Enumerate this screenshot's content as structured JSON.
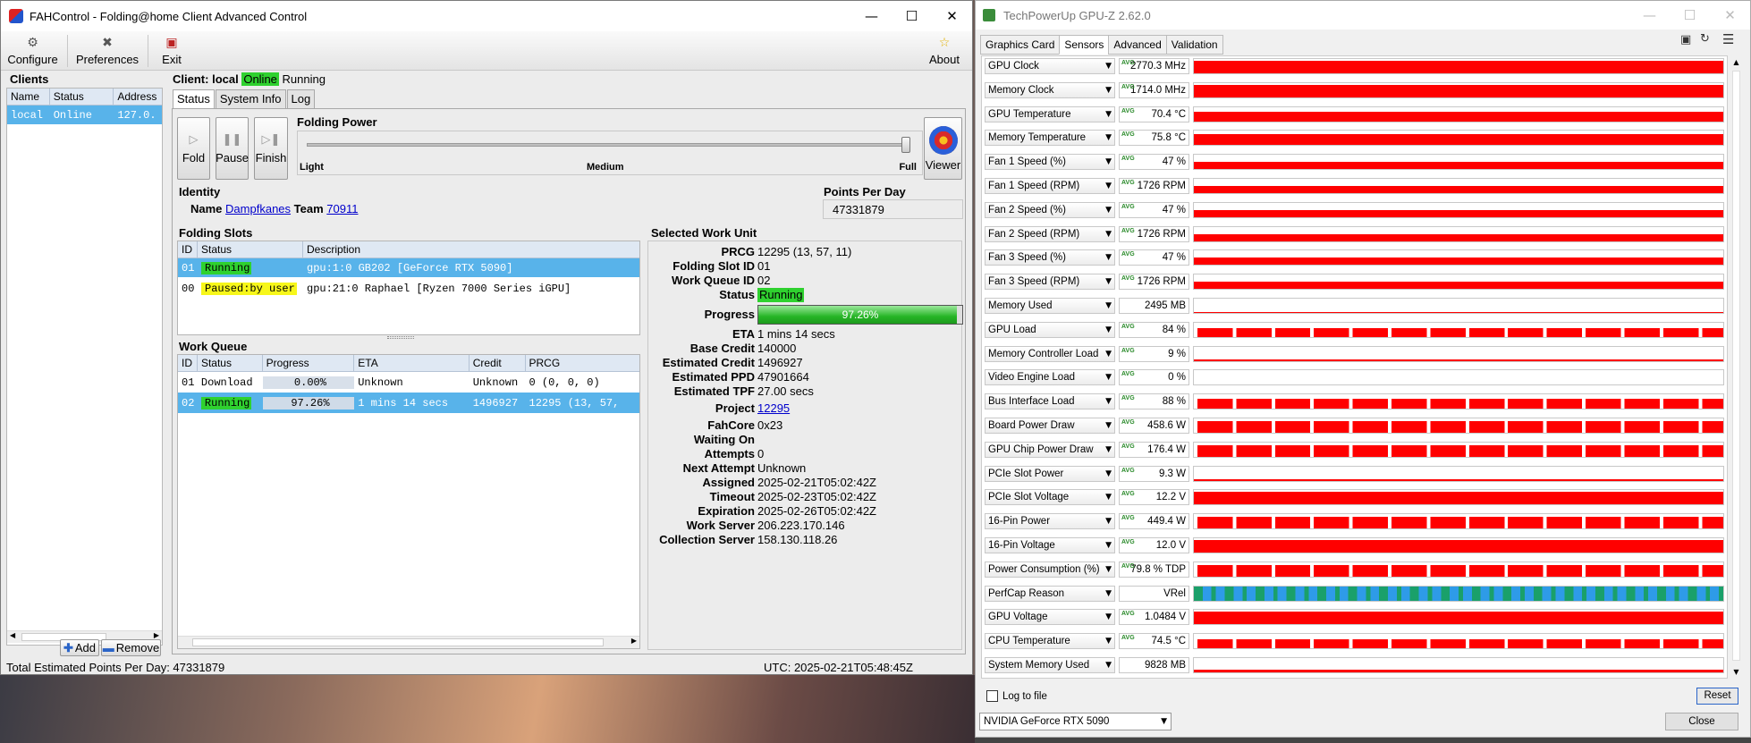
{
  "fah": {
    "window_title": "FAHControl - Folding@home Client Advanced Control",
    "toolbar": {
      "configure": "Configure",
      "preferences": "Preferences",
      "exit": "Exit",
      "about": "About"
    },
    "clients": {
      "title": "Clients",
      "headers": [
        "Name",
        "Status",
        "Address"
      ],
      "row": {
        "name": "local",
        "status": "Online",
        "address": "127.0."
      },
      "add": "Add",
      "remove": "Remove"
    },
    "client_header": {
      "label": "Client:",
      "name": "local",
      "online": "Online",
      "state": "Running"
    },
    "tabs": [
      "Status",
      "System Info",
      "Log"
    ],
    "buttons": {
      "fold": "Fold",
      "pause": "Pause",
      "finish": "Finish",
      "viewer": "Viewer"
    },
    "folding_power": {
      "title": "Folding Power",
      "light": "Light",
      "medium": "Medium",
      "full": "Full",
      "level": 1.0
    },
    "identity": {
      "title": "Identity",
      "name_label": "Name",
      "name": "Dampfkanes",
      "team_label": "Team",
      "team": "70911"
    },
    "ppd": {
      "title": "Points Per Day",
      "value": "47331879"
    },
    "slots": {
      "title": "Folding Slots",
      "headers": [
        "ID",
        "Status",
        "Description"
      ],
      "rows": [
        {
          "id": "01",
          "status": "Running",
          "desc": "gpu:1:0 GB202 [GeForce RTX 5090]"
        },
        {
          "id": "00",
          "status": "Paused:by user",
          "desc": "gpu:21:0 Raphael [Ryzen 7000 Series iGPU]"
        }
      ]
    },
    "queue": {
      "title": "Work Queue",
      "headers": [
        "ID",
        "Status",
        "Progress",
        "ETA",
        "Credit",
        "PRCG"
      ],
      "rows": [
        {
          "id": "01",
          "status": "Download",
          "progress": "0.00%",
          "eta": "Unknown",
          "credit": "Unknown",
          "prcg": "0 (0, 0, 0)"
        },
        {
          "id": "02",
          "status": "Running",
          "progress": "97.26%",
          "eta": "1 mins 14 secs",
          "credit": "1496927",
          "prcg": "12295 (13, 57,"
        }
      ]
    },
    "wu": {
      "title": "Selected Work Unit",
      "prcg_l": "PRCG",
      "prcg": "12295 (13, 57, 11)",
      "slot_l": "Folding Slot ID",
      "slot": "01",
      "queue_l": "Work Queue ID",
      "queue": "02",
      "status_l": "Status",
      "status": "Running",
      "progress_l": "Progress",
      "progress": "97.26%",
      "progress_fraction": 0.9726,
      "eta_l": "ETA",
      "eta": "1 mins 14 secs",
      "base_l": "Base Credit",
      "base": "140000",
      "est_credit_l": "Estimated Credit",
      "est_credit": "1496927",
      "est_ppd_l": "Estimated PPD",
      "est_ppd": "47901664",
      "est_tpf_l": "Estimated TPF",
      "est_tpf": "27.00 secs",
      "project_l": "Project",
      "project": "12295",
      "core_l": "FahCore",
      "core": "0x23",
      "waiting_l": "Waiting On",
      "waiting": "",
      "attempts_l": "Attempts",
      "attempts": "0",
      "next_l": "Next Attempt",
      "next": "Unknown",
      "assigned_l": "Assigned",
      "assigned": "2025-02-21T05:02:42Z",
      "timeout_l": "Timeout",
      "timeout": "2025-02-23T05:02:42Z",
      "expiration_l": "Expiration",
      "expiration": "2025-02-26T05:02:42Z",
      "ws_l": "Work Server",
      "ws": "206.223.170.146",
      "cs_l": "Collection Server",
      "cs": "158.130.118.26"
    },
    "statusbar": {
      "total": "Total Estimated Points Per Day: 47331879",
      "utc": "UTC: 2025-02-21T05:48:45Z"
    }
  },
  "gpuz": {
    "window_title": "TechPowerUp GPU-Z 2.62.0",
    "tabs": [
      "Graphics Card",
      "Sensors",
      "Advanced",
      "Validation"
    ],
    "avg_tag": "AVG",
    "sensors": [
      {
        "name": "GPU Clock",
        "value": "2770.3 MHz",
        "avg": true,
        "level": 0.85,
        "style": "solid"
      },
      {
        "name": "Memory Clock",
        "value": "1714.0 MHz",
        "avg": true,
        "level": 0.85,
        "style": "solid"
      },
      {
        "name": "GPU Temperature",
        "value": "70.4 °C",
        "avg": true,
        "level": 0.7,
        "style": "solid"
      },
      {
        "name": "Memory Temperature",
        "value": "75.8 °C",
        "avg": true,
        "level": 0.72,
        "style": "solid"
      },
      {
        "name": "Fan 1 Speed (%)",
        "value": "47 %",
        "avg": true,
        "level": 0.47,
        "style": "solid"
      },
      {
        "name": "Fan 1 Speed (RPM)",
        "value": "1726 RPM",
        "avg": true,
        "level": 0.47,
        "style": "solid"
      },
      {
        "name": "Fan 2 Speed (%)",
        "value": "47 %",
        "avg": true,
        "level": 0.47,
        "style": "solid"
      },
      {
        "name": "Fan 2 Speed (RPM)",
        "value": "1726 RPM",
        "avg": true,
        "level": 0.47,
        "style": "solid"
      },
      {
        "name": "Fan 3 Speed (%)",
        "value": "47 %",
        "avg": true,
        "level": 0.47,
        "style": "solid"
      },
      {
        "name": "Fan 3 Speed (RPM)",
        "value": "1726 RPM",
        "avg": true,
        "level": 0.47,
        "style": "solid"
      },
      {
        "name": "Memory Used",
        "value": "2495 MB",
        "avg": false,
        "level": 0.08,
        "style": "solid"
      },
      {
        "name": "GPU Load",
        "value": "84 %",
        "avg": true,
        "level": 0.6,
        "style": "noisy"
      },
      {
        "name": "Memory Controller Load",
        "value": "9 %",
        "avg": true,
        "level": 0.1,
        "style": "solid"
      },
      {
        "name": "Video Engine Load",
        "value": "0 %",
        "avg": true,
        "level": 0,
        "style": "solid"
      },
      {
        "name": "Bus Interface Load",
        "value": "88 %",
        "avg": true,
        "level": 0.7,
        "style": "noisy"
      },
      {
        "name": "Board Power Draw",
        "value": "458.6 W",
        "avg": true,
        "level": 0.8,
        "style": "noisy"
      },
      {
        "name": "GPU Chip Power Draw",
        "value": "176.4 W",
        "avg": true,
        "level": 0.8,
        "style": "noisy"
      },
      {
        "name": "PCIe Slot Power",
        "value": "9.3 W",
        "avg": true,
        "level": 0.12,
        "style": "solid"
      },
      {
        "name": "PCIe Slot Voltage",
        "value": "12.2 V",
        "avg": true,
        "level": 0.85,
        "style": "solid"
      },
      {
        "name": "16-Pin Power",
        "value": "449.4 W",
        "avg": true,
        "level": 0.8,
        "style": "noisy"
      },
      {
        "name": "16-Pin Voltage",
        "value": "12.0 V",
        "avg": true,
        "level": 0.85,
        "style": "solid"
      },
      {
        "name": "Power Consumption (%)",
        "value": "79.8 % TDP",
        "avg": true,
        "level": 0.8,
        "style": "noisy"
      },
      {
        "name": "PerfCap Reason",
        "value": "VRel",
        "avg": false,
        "level": 1,
        "style": "perfcap"
      },
      {
        "name": "GPU Voltage",
        "value": "1.0484 V",
        "avg": true,
        "level": 0.85,
        "style": "solid"
      },
      {
        "name": "CPU Temperature",
        "value": "74.5 °C",
        "avg": true,
        "level": 0.6,
        "style": "noisy"
      },
      {
        "name": "System Memory Used",
        "value": "9828 MB",
        "avg": false,
        "level": 0.2,
        "style": "solid"
      }
    ],
    "log_to_file": "Log to file",
    "reset": "Reset",
    "device": "NVIDIA GeForce RTX 5090",
    "close": "Close",
    "colors": {
      "graph": "#ff0000",
      "perfcap_blue": "#2e9be8",
      "perfcap_green": "#1aa06a"
    }
  }
}
